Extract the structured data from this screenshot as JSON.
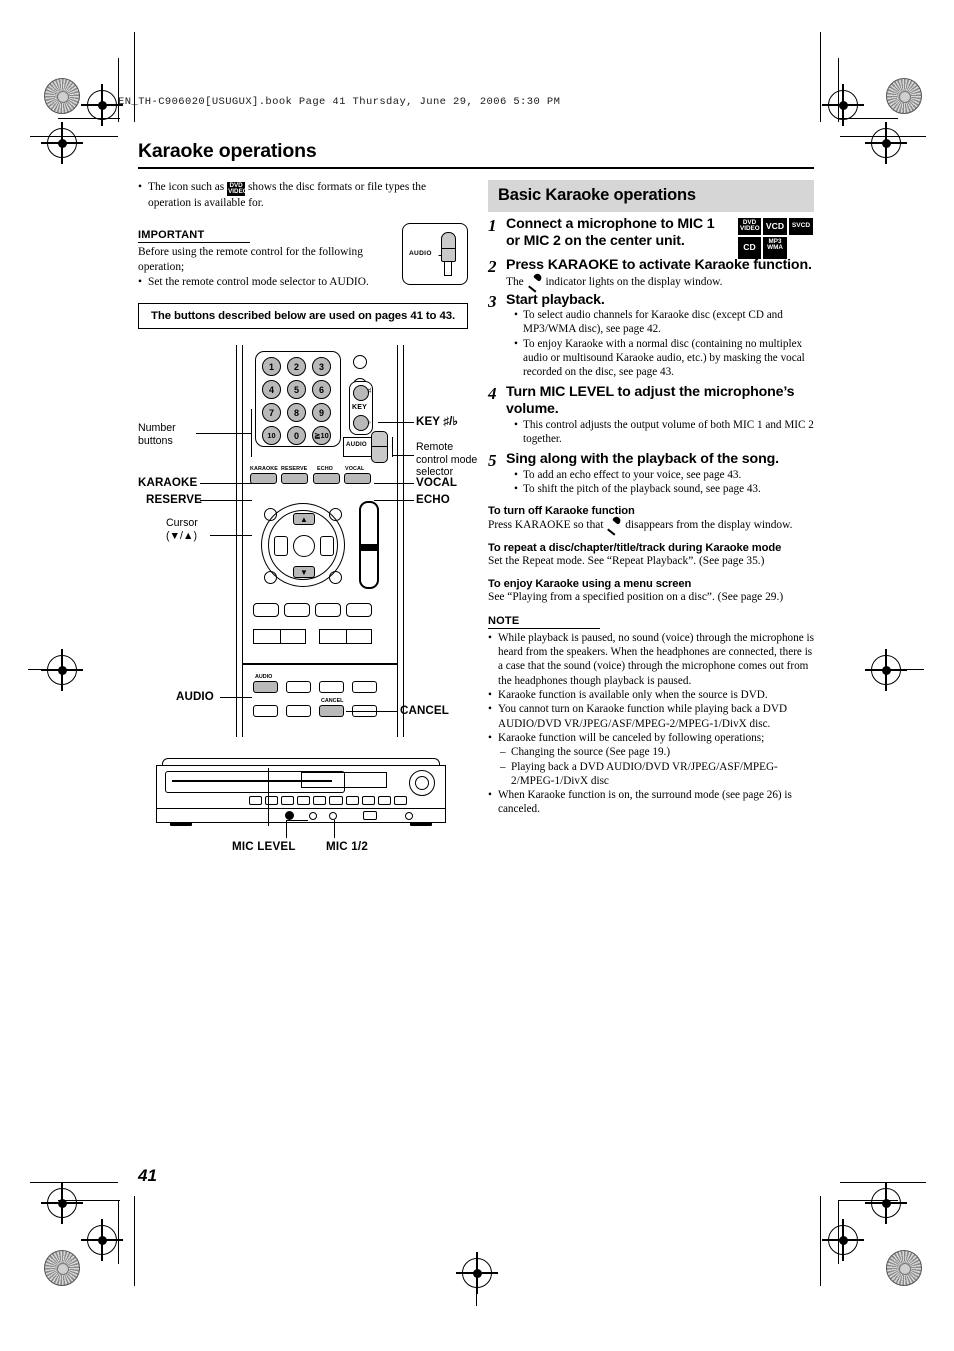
{
  "file_header": "EN_TH-C906020[USUGUX].book  Page 41  Thursday, June 29, 2006  5:30 PM",
  "page_title": "Karaoke operations",
  "page_number": "41",
  "left": {
    "intro_bullet_before": "The icon such as",
    "intro_bullet_after": "shows the disc formats or file types the operation is available for.",
    "important_heading": "IMPORTANT",
    "important_body": "Before using the remote control for the following operation;",
    "important_bullet": "Set the remote control mode selector to AUDIO.",
    "audio_selector_label": "AUDIO",
    "pages_box": "The buttons described below are used on pages 41 to 43.",
    "remote": {
      "number_buttons_label": "Number\nbuttons",
      "number_buttons_label_1": "Number",
      "number_buttons_label_2": "buttons",
      "keys": [
        "1",
        "2",
        "3",
        "4",
        "5",
        "6",
        "7",
        "8",
        "9",
        "10",
        "0",
        "≧10"
      ],
      "key_label": "KEY ♯/♭",
      "key_pad_text": "KEY",
      "key_sharp": "♯",
      "key_flat": "♭",
      "audio_mini_label": "AUDIO",
      "mode_selector_label_1": "Remote",
      "mode_selector_label_2": "control mode",
      "mode_selector_label_3": "selector",
      "fn_buttons": [
        "KARAOKE",
        "RESERVE",
        "ECHO",
        "VOCAL"
      ],
      "label_karaoke": "KARAOKE",
      "label_reserve": "RESERVE",
      "label_vocal": "VOCAL",
      "label_echo": "ECHO",
      "cursor_label_1": "Cursor",
      "cursor_label_2": "(▼/▲)",
      "label_audio": "AUDIO",
      "label_cancel": "CANCEL",
      "btn_audio_text": "AUDIO",
      "btn_cancel_text": "CANCEL",
      "up_arrow": "▲",
      "down_arrow": "▼"
    },
    "unit": {
      "mic_level_label": "MIC LEVEL",
      "mic_12_label": "MIC 1/2"
    }
  },
  "right": {
    "banner": "Basic Karaoke operations",
    "disc_icons": [
      [
        "DVD\nVIDEO",
        "VCD",
        "SVCD"
      ],
      [
        "CD",
        "MP3\nWMA"
      ]
    ],
    "disc_icon_dvd_l1": "DVD",
    "disc_icon_dvd_l2": "VIDEO",
    "disc_icon_vcd": "VCD",
    "disc_icon_svcd": "SVCD",
    "disc_icon_cd": "CD",
    "disc_icon_mp3_l1": "MP3",
    "disc_icon_mp3_l2": "WMA",
    "steps": [
      {
        "num": "1",
        "title": "Connect a microphone to MIC 1 or MIC 2 on the center unit.",
        "note": "",
        "bullets": []
      },
      {
        "num": "2",
        "title": "Press KARAOKE to activate Karaoke function.",
        "note_before": "The",
        "note_after": "indicator lights on the display window.",
        "bullets": []
      },
      {
        "num": "3",
        "title": "Start playback.",
        "bullets": [
          "To select audio channels for Karaoke disc (except CD and MP3/WMA disc), see page 42.",
          "To enjoy Karaoke with a normal disc (containing no multiplex audio or multisound Karaoke audio, etc.) by masking the vocal recorded on the disc, see page 43."
        ]
      },
      {
        "num": "4",
        "title": "Turn MIC LEVEL to adjust the microphone’s volume.",
        "bullets": [
          "This control adjusts the output volume of both MIC 1 and MIC 2 together."
        ]
      },
      {
        "num": "5",
        "title": "Sing along with the playback of the song.",
        "bullets": [
          "To add an echo effect to your voice, see page 43.",
          "To shift the pitch of the playback sound, see page 43."
        ]
      }
    ],
    "subsections": [
      {
        "heading": "To turn off Karaoke function",
        "body_before": "Press KARAOKE so that",
        "body_after": "disappears from the display window."
      },
      {
        "heading": "To repeat a disc/chapter/title/track during Karaoke mode",
        "body": "Set the Repeat mode. See “Repeat Playback”. (See page 35.)"
      },
      {
        "heading": "To enjoy Karaoke using a menu screen",
        "body": "See “Playing from a specified position on a disc”. (See page 29.)"
      }
    ],
    "note_heading": "NOTE",
    "notes": [
      "While playback is paused, no sound (voice) through the microphone is heard from the speakers. When the headphones are connected, there is a case that the sound (voice) through the microphone comes out from the headphones though playback is paused.",
      "Karaoke function is available only when the source is DVD.",
      "You cannot turn on Karaoke function while playing back a DVD AUDIO/DVD VR/JPEG/ASF/MPEG-2/MPEG-1/DivX disc.",
      "Karaoke function will be canceled by following operations;",
      "When Karaoke function is on, the surround mode (see page 26) is canceled."
    ],
    "note_sub_dashes": [
      "Changing the source (See page 19.)",
      "Playing back a DVD AUDIO/DVD VR/JPEG/ASF/MPEG-2/MPEG-1/DivX disc"
    ]
  },
  "colors": {
    "banner_bg": "#d6d6d6",
    "button_gray": "#b9b9b9",
    "ink": "#000000"
  }
}
